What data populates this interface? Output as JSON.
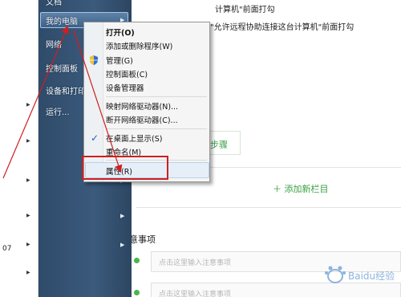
{
  "left_column": {
    "arrows": [
      "▶",
      "▶",
      "▶",
      "▶",
      "▶",
      "▶"
    ],
    "number": "07"
  },
  "start_menu": {
    "items": [
      {
        "label": "文档",
        "has_arrow": false
      },
      {
        "label": "我的电脑",
        "has_arrow": true
      },
      {
        "label": "网络",
        "has_arrow": false
      },
      {
        "label": "控制面板",
        "has_arrow": false
      },
      {
        "label": "设备和打印",
        "has_arrow": false
      },
      {
        "label": "运行...",
        "has_arrow": false
      }
    ],
    "right_arrows": [
      "▶",
      "▶",
      "▶",
      "▶",
      "▶"
    ]
  },
  "context_menu": {
    "items": [
      {
        "label": "打开(O)",
        "bold": true
      },
      {
        "label": "添加或删除程序(W)"
      },
      {
        "label": "管理(G)",
        "icon": "shield-icon"
      },
      {
        "label": "控制面板(C)"
      },
      {
        "label": "设备管理器"
      },
      {
        "label": "映射网络驱动器(N)..."
      },
      {
        "label": "断开网络驱动器(C)..."
      },
      {
        "label": "在桌面上显示(S)",
        "checked": true
      },
      {
        "label": "重命名(M)"
      },
      {
        "label": "属性(R)",
        "selected": true
      }
    ]
  },
  "webpage": {
    "line1": "计算机\"前面打勾",
    "line2": "\"允许远程协助连接这台计算机\"前面打勾",
    "step_button": "步骤",
    "add_column": "＋ 添加新栏目",
    "section_title": "注意事项",
    "todo_placeholders": [
      "点击这里输入注意事项",
      "点击这里输入注意事项"
    ]
  },
  "colors": {
    "start_panel": "#3b5a7c",
    "accent_green": "#3aa145",
    "annotation_red": "#cf1f1f"
  },
  "watermark": {
    "text": "Baidu经验"
  }
}
